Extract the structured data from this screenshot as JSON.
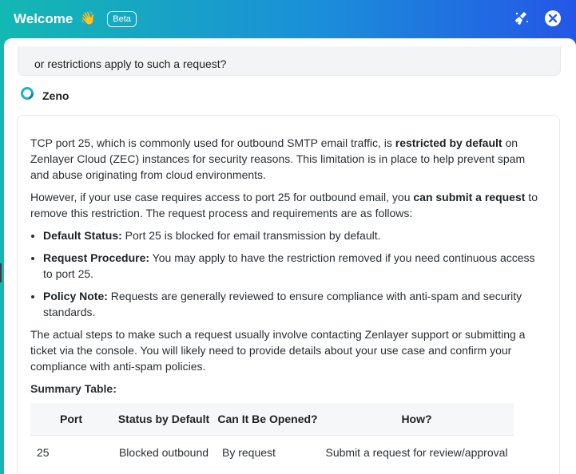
{
  "header": {
    "title": "Welcome",
    "badge": "Beta",
    "wave_emoji": "👋",
    "icons": [
      "broom-icon",
      "close-icon"
    ]
  },
  "user_message": {
    "text": "or restrictions apply to such a request?"
  },
  "bot": {
    "name": "Zeno",
    "icon": "zeno-logo-icon",
    "accent": "#19b3c4"
  },
  "answer": {
    "p1_a": "TCP port 25, which is commonly used for outbound SMTP email traffic, is ",
    "p1_b": "restricted by default",
    "p1_c": " on Zenlayer Cloud (ZEC) instances for security reasons. This limitation is in place to help prevent spam and abuse originating from cloud environments.",
    "p2_a": "However, if your use case requires access to port 25 for outbound email, you ",
    "p2_b": "can submit a request",
    "p2_c": " to remove this restriction. The request process and requirements are as follows:",
    "bullets": [
      {
        "label": "Default Status:",
        "text": " Port 25 is blocked for email transmission by default."
      },
      {
        "label": "Request Procedure:",
        "text": " You may apply to have the restriction removed if you need continuous access to port 25."
      },
      {
        "label": "Policy Note:",
        "text": " Requests are generally reviewed to ensure compliance with anti-spam and security standards."
      }
    ],
    "p3": "The actual steps to make such a request usually involve contacting Zenlayer support or submitting a ticket via the console. You will likely need to provide details about your use case and confirm your compliance with anti-spam policies.",
    "summary_title": "Summary Table:",
    "table": {
      "headers": [
        "Port",
        "Status by Default",
        "Can It Be Opened?",
        "How?"
      ],
      "rows": [
        [
          "25",
          "Blocked outbound",
          "By request",
          "Submit a request for review/approval"
        ]
      ]
    }
  }
}
